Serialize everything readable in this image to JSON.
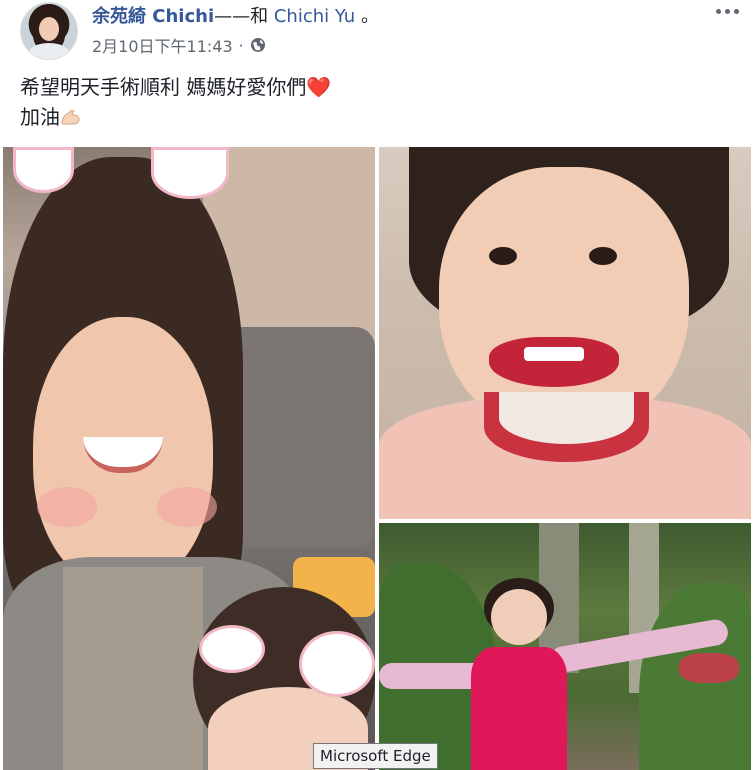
{
  "post": {
    "author": "余苑綺 Chichi",
    "with_text": "——和",
    "tagged": "Chichi Yu",
    "period": "。",
    "timestamp": "2月10日下午11:43",
    "separator": "·",
    "privacy_icon": "globe-icon",
    "more_icon": "more-options-icon",
    "text_line_1": "希望明天手術順利 媽媽好愛你們",
    "heart_emoji": "❤️",
    "text_line_2": "加油",
    "muscle_emoji": "muscle-emoji-icon"
  },
  "photos": [
    {
      "name": "photo-mother-bunny-filter"
    },
    {
      "name": "photo-girl-lipstick"
    },
    {
      "name": "photo-girl-outdoors"
    }
  ],
  "tooltip": {
    "text": "Microsoft Edge"
  }
}
